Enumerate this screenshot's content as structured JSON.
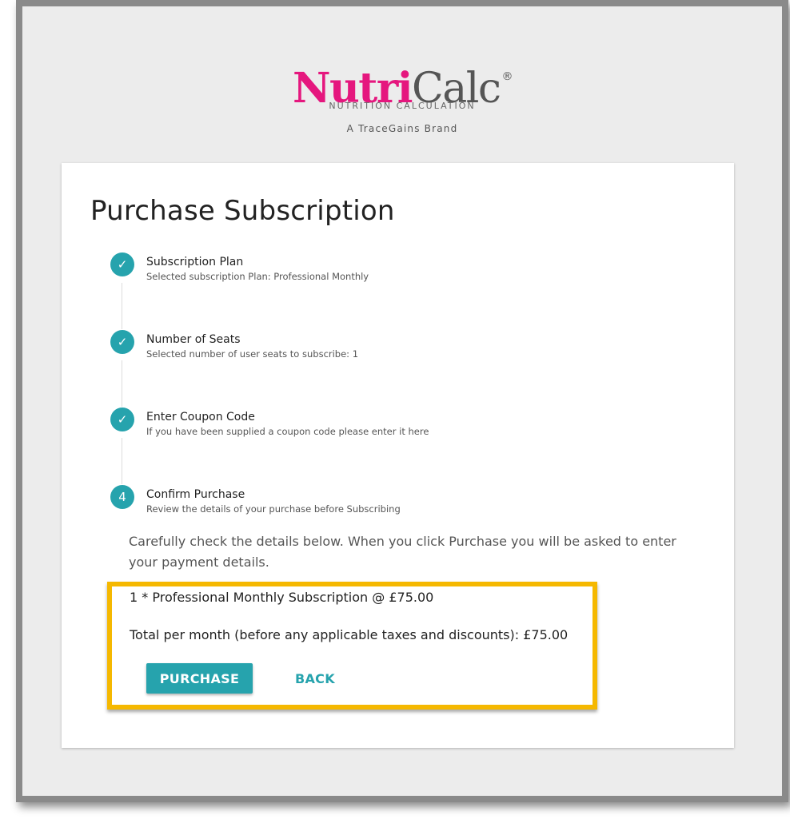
{
  "brand": {
    "logo_primary": "Nutri",
    "logo_secondary": "Calc",
    "registered_mark": "®",
    "tagline": "NUTRITION CALCULATION",
    "brand_line": "A TraceGains Brand"
  },
  "colors": {
    "accent": "#26a3ad",
    "logo_pink": "#e5177e",
    "highlight_border": "#f5b800"
  },
  "page": {
    "title": "Purchase Subscription"
  },
  "steps": [
    {
      "marker": "✓",
      "status": "complete",
      "title": "Subscription Plan",
      "subtitle": "Selected subscription Plan: Professional Monthly"
    },
    {
      "marker": "✓",
      "status": "complete",
      "title": "Number of Seats",
      "subtitle": "Selected number of user seats to subscribe: 1"
    },
    {
      "marker": "✓",
      "status": "complete",
      "title": "Enter Coupon Code",
      "subtitle": "If you have been supplied a coupon code please enter it here"
    },
    {
      "marker": "4",
      "status": "active",
      "title": "Confirm Purchase",
      "subtitle": "Review the details of your purchase before Subscribing"
    }
  ],
  "confirm": {
    "description": "Carefully check the details below. When you click Purchase you will be asked to enter your payment details.",
    "line_item": "1 * Professional Monthly Subscription @ £75.00",
    "total": "Total per month (before any applicable taxes and discounts): £75.00",
    "purchase_label": "PURCHASE",
    "back_label": "BACK"
  }
}
